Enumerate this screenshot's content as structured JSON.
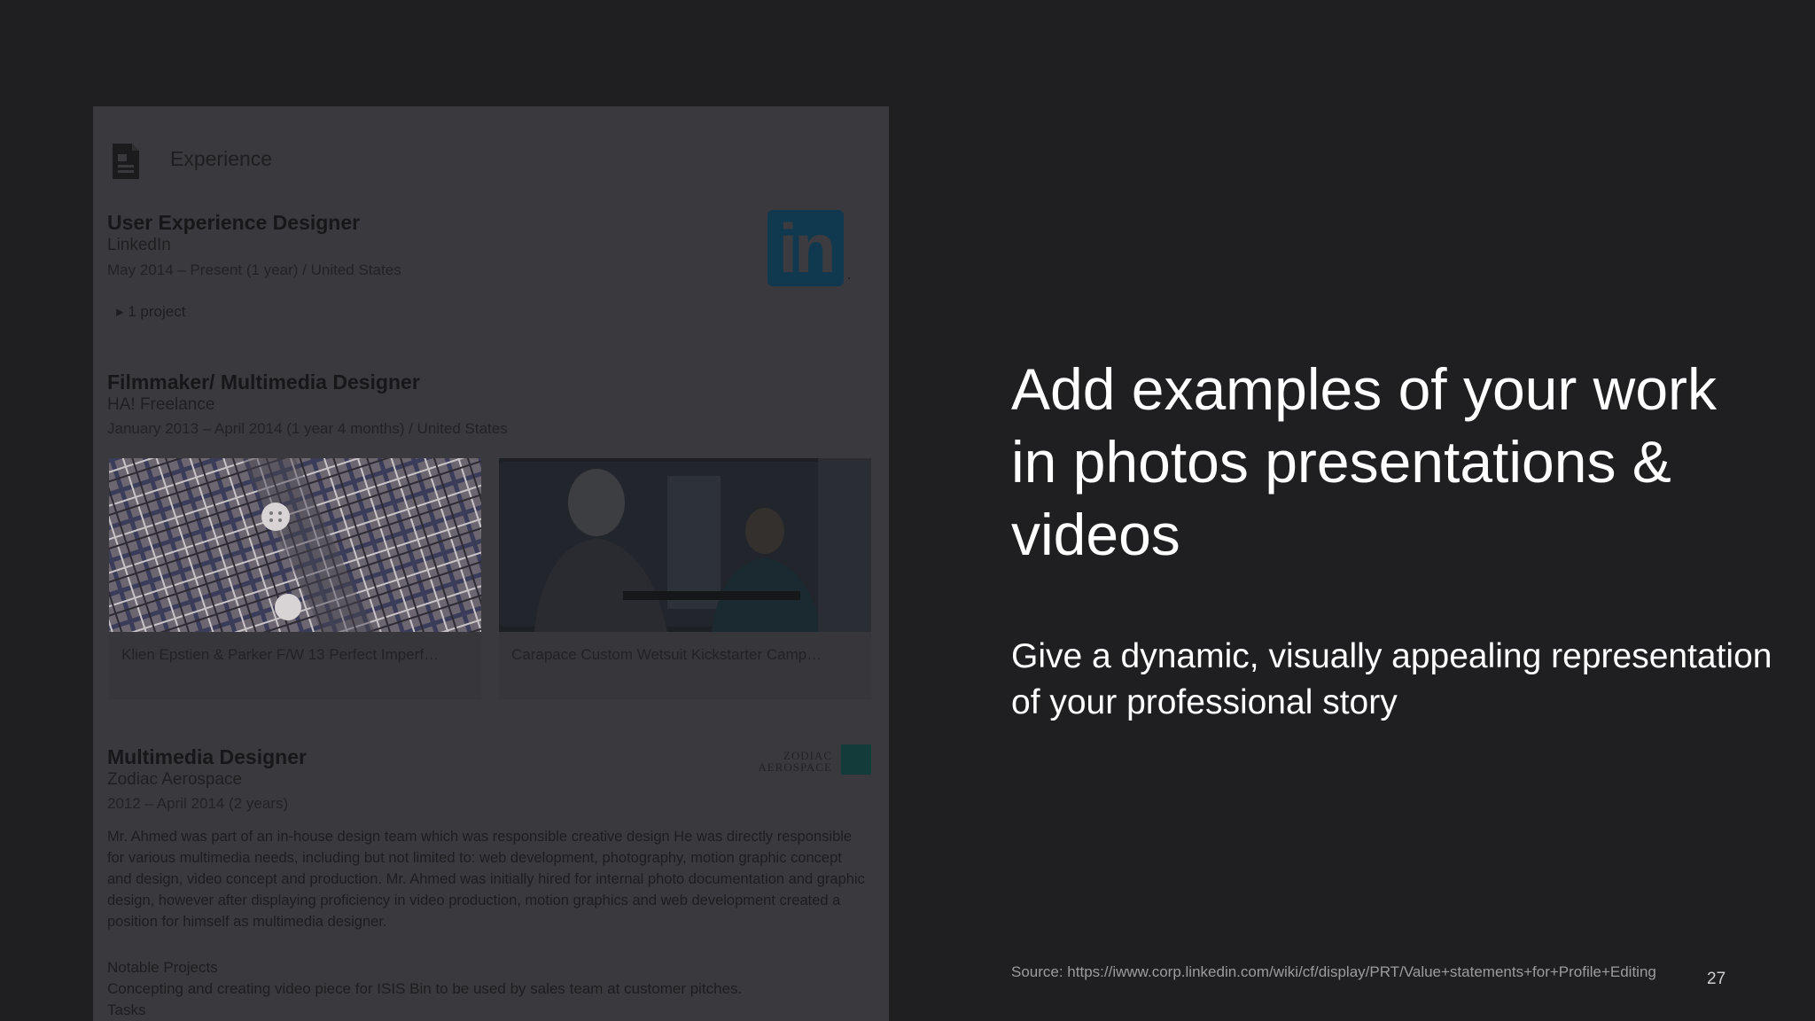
{
  "screenshot": {
    "section_title": "Experience",
    "jobs": [
      {
        "title": "User Experience Designer",
        "company": "LinkedIn",
        "meta": "May 2014 – Present (1 year)  /  United States",
        "project": "▸  1 project",
        "logo": "in"
      },
      {
        "title": "Filmmaker/ Multimedia Designer",
        "company": "HA! Freelance",
        "meta": "January 2013 – April 2014 (1 year 4 months)  /  United States",
        "media": [
          {
            "caption": "Klien Epstien & Parker F/W 13 Perfect Imperf…"
          },
          {
            "caption": "Carapace Custom Wetsuit Kickstarter Camp…"
          }
        ]
      },
      {
        "title": "Multimedia Designer",
        "company": "Zodiac Aerospace",
        "meta": "2012 – April 2014 (2 years)",
        "logo_text_1": "ZODIAC",
        "logo_text_2": "AEROSPACE",
        "description": "Mr. Ahmed was part of an in-house design team which was responsible creative design He was directly responsible for various multimedia needs, including but not limited to: web development, photography, motion graphic concept and design, video concept and production. Mr. Ahmed was initially hired for internal photo documentation and graphic design, however after displaying proficiency in video production, motion graphics and web development created a position for himself as multimedia designer.",
        "notable_heading": "Notable Projects",
        "notable_item": "Concepting and creating video piece for ISIS Bin to be used by sales team at customer pitches.",
        "tasks_heading": "Tasks"
      }
    ]
  },
  "headline": "Add examples of your work in photos presentations & videos",
  "subline": "Give a dynamic, visually appealing representation of your professional story",
  "source": "Source: https://iwww.corp.linkedin.com/wiki/cf/display/PRT/Value+statements+for+Profile+Editing",
  "page_number": "27"
}
